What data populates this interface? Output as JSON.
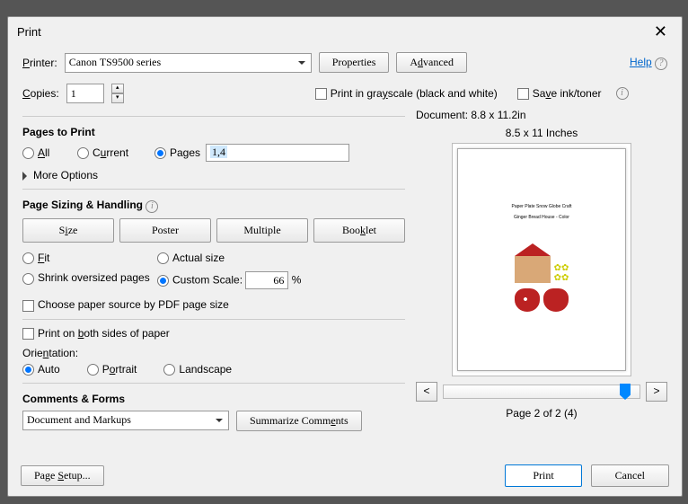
{
  "title": "Print",
  "printerLabel": "Printer:",
  "printerSelected": "Canon TS9500 series",
  "propertiesBtn": "Properties",
  "advancedBtn": "Advanced",
  "helpLink": "Help",
  "copiesLabel": "Copies:",
  "copiesValue": "1",
  "grayscale": "Print in grayscale (black and white)",
  "saveInk": "Save ink/toner",
  "pagesToPrint": "Pages to Print",
  "all": "All",
  "current": "Current",
  "pages": "Pages",
  "pagesValue": "1,4",
  "moreOptions": "More Options",
  "sizing": "Page Sizing & Handling",
  "tabSize": "Size",
  "tabPoster": "Poster",
  "tabMultiple": "Multiple",
  "tabBooklet": "Booklet",
  "fit": "Fit",
  "actualSize": "Actual size",
  "shrink": "Shrink oversized pages",
  "customScale": "Custom Scale:",
  "scaleValue": "66",
  "pct": "%",
  "paperSource": "Choose paper source by PDF page size",
  "bothSides": "Print on both sides of paper",
  "orientationLabel": "Orientation:",
  "oAuto": "Auto",
  "oPortrait": "Portrait",
  "oLandscape": "Landscape",
  "commentsForms": "Comments & Forms",
  "commentsSelected": "Document and Markups",
  "summarize": "Summarize Comments",
  "docSize": "Document: 8.8 x 11.2in",
  "paperSize": "8.5 x 11 Inches",
  "previewTitle": "Paper Plate Snow Globe Craft",
  "previewSub": "Ginger Bread House - Color",
  "prevBtn": "<",
  "nextBtn": ">",
  "pageStatus": "Page 2 of 2 (4)",
  "pageSetup": "Page Setup...",
  "printBtn": "Print",
  "cancelBtn": "Cancel"
}
